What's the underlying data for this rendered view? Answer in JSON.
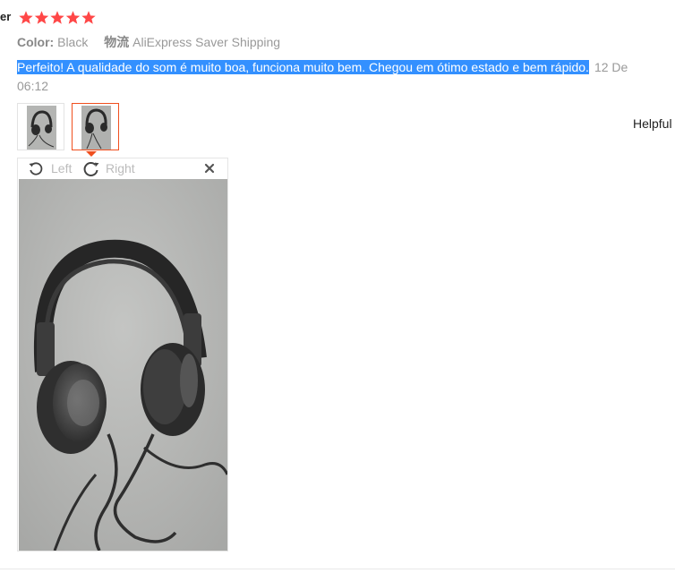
{
  "review": {
    "name_fragment": "er",
    "rating": 5,
    "color_label": "Color:",
    "color_value": "Black",
    "shipping_label": "物流",
    "shipping_value": "AliExpress Saver Shipping",
    "feedback_text": "Perfeito! A qualidade do som é muito boa, funciona muito bem. Chegou em ótimo estado e bem rápido.",
    "date_line1": "12 De",
    "date_line2": "06:12",
    "helpful_label": "Helpful"
  },
  "viewer": {
    "rotate_left_label": "Left",
    "rotate_right_label": "Right"
  },
  "colors": {
    "star": "#ff4747",
    "selection": "#3390ff",
    "active_thumb_border": "#f04f1e"
  },
  "icons": [
    "star-icon",
    "rotate-left-icon",
    "rotate-right-icon",
    "close-icon"
  ]
}
